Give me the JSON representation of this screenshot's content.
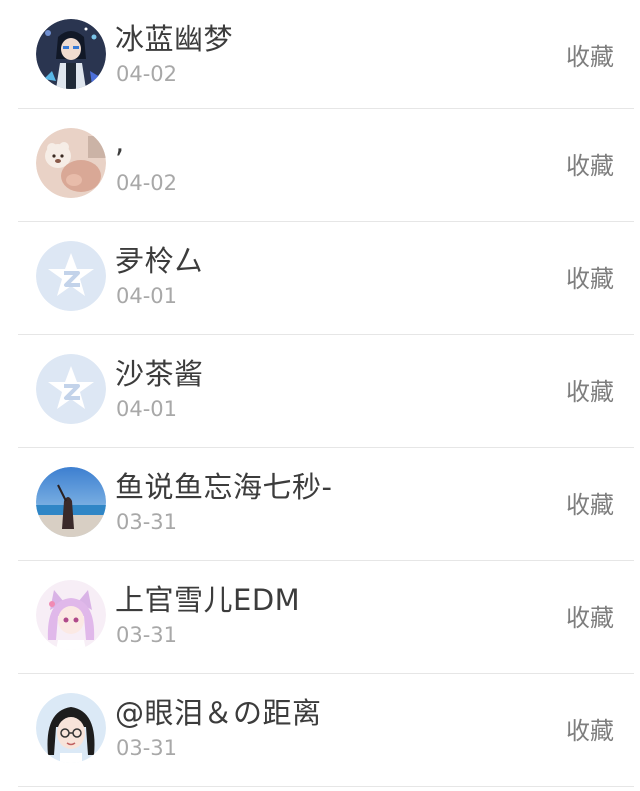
{
  "items": [
    {
      "name": "冰蓝幽梦",
      "date": "04-02",
      "action": "收藏",
      "avatar_icon": "anime-character-avatar"
    },
    {
      "name": ",",
      "date": "04-02",
      "action": "收藏",
      "avatar_icon": "plush-toy-photo-avatar"
    },
    {
      "name": "夛柃厶",
      "date": "04-01",
      "action": "收藏",
      "avatar_icon": "default-qzone-avatar"
    },
    {
      "name": "沙茶酱",
      "date": "04-01",
      "action": "收藏",
      "avatar_icon": "default-qzone-avatar"
    },
    {
      "name": "鱼说鱼忘海七秒-",
      "date": "03-31",
      "action": "收藏",
      "avatar_icon": "beach-photo-avatar"
    },
    {
      "name": "上官雪儿EDM",
      "date": "03-31",
      "action": "收藏",
      "avatar_icon": "anime-catgirl-avatar"
    },
    {
      "name": "@眼泪＆の距离",
      "date": "03-31",
      "action": "收藏",
      "avatar_icon": "anime-girl-glasses-avatar"
    }
  ],
  "colors": {
    "name": "#3c3c3c",
    "date": "#a8a8a8",
    "action": "#7e7e7e",
    "divider": "#e6e6e6",
    "default_avatar_bg": "#dde7f4"
  }
}
